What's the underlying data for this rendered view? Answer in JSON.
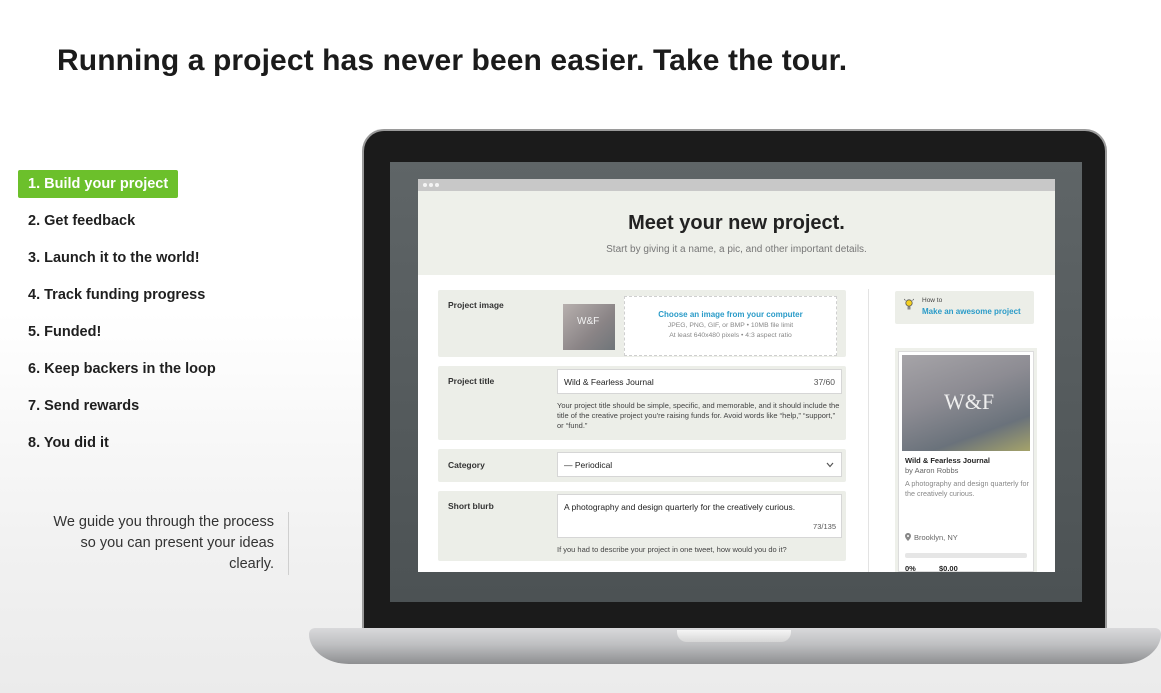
{
  "headline": "Running a project has never been easier. Take the tour.",
  "steps": [
    {
      "label": "1. Build your project",
      "active": true
    },
    {
      "label": "2. Get feedback"
    },
    {
      "label": "3. Launch it to the world!"
    },
    {
      "label": "4. Track funding progress"
    },
    {
      "label": "5. Funded!"
    },
    {
      "label": "6. Keep backers in the loop"
    },
    {
      "label": "7. Send rewards"
    },
    {
      "label": "8. You did it"
    }
  ],
  "blurb": "We guide you through the process so you can present your ideas clearly.",
  "screen": {
    "hero_title": "Meet your new project.",
    "hero_subtitle": "Start by giving it a name, a pic, and other important details.",
    "project_image": {
      "label": "Project image",
      "thumb_text": "W&F",
      "choose_link": "Choose an image from your computer",
      "note1": "JPEG, PNG, GIF, or BMP • 10MB file limit",
      "note2": "At least 640x480 pixels • 4:3 aspect ratio"
    },
    "project_title": {
      "label": "Project title",
      "value": "Wild & Fearless Journal",
      "count": "37/60",
      "help": "Your project title should be simple, specific, and memorable, and it should include the title of the creative project you're raising funds for. Avoid words like “help,” “support,” or “fund.”"
    },
    "category": {
      "label": "Category",
      "value": "— Periodical"
    },
    "short_blurb": {
      "label": "Short blurb",
      "value": "A photography and design quarterly for the creatively curious.",
      "count": "73/135",
      "help": "If you had to describe your project in one tweet, how would you do it?"
    },
    "howto": {
      "small": "How to",
      "link": "Make an awesome project"
    },
    "card": {
      "image_text": "W&F",
      "title": "Wild & Fearless Journal",
      "author": "by Aaron Robbs",
      "desc": "A photography and design quarterly for the creatively curious.",
      "location": "Brooklyn, NY",
      "funded": "0%",
      "pledged": "$0.00"
    }
  },
  "colors": {
    "accent_green": "#6cc02b",
    "link_blue": "#2a9bc8"
  }
}
